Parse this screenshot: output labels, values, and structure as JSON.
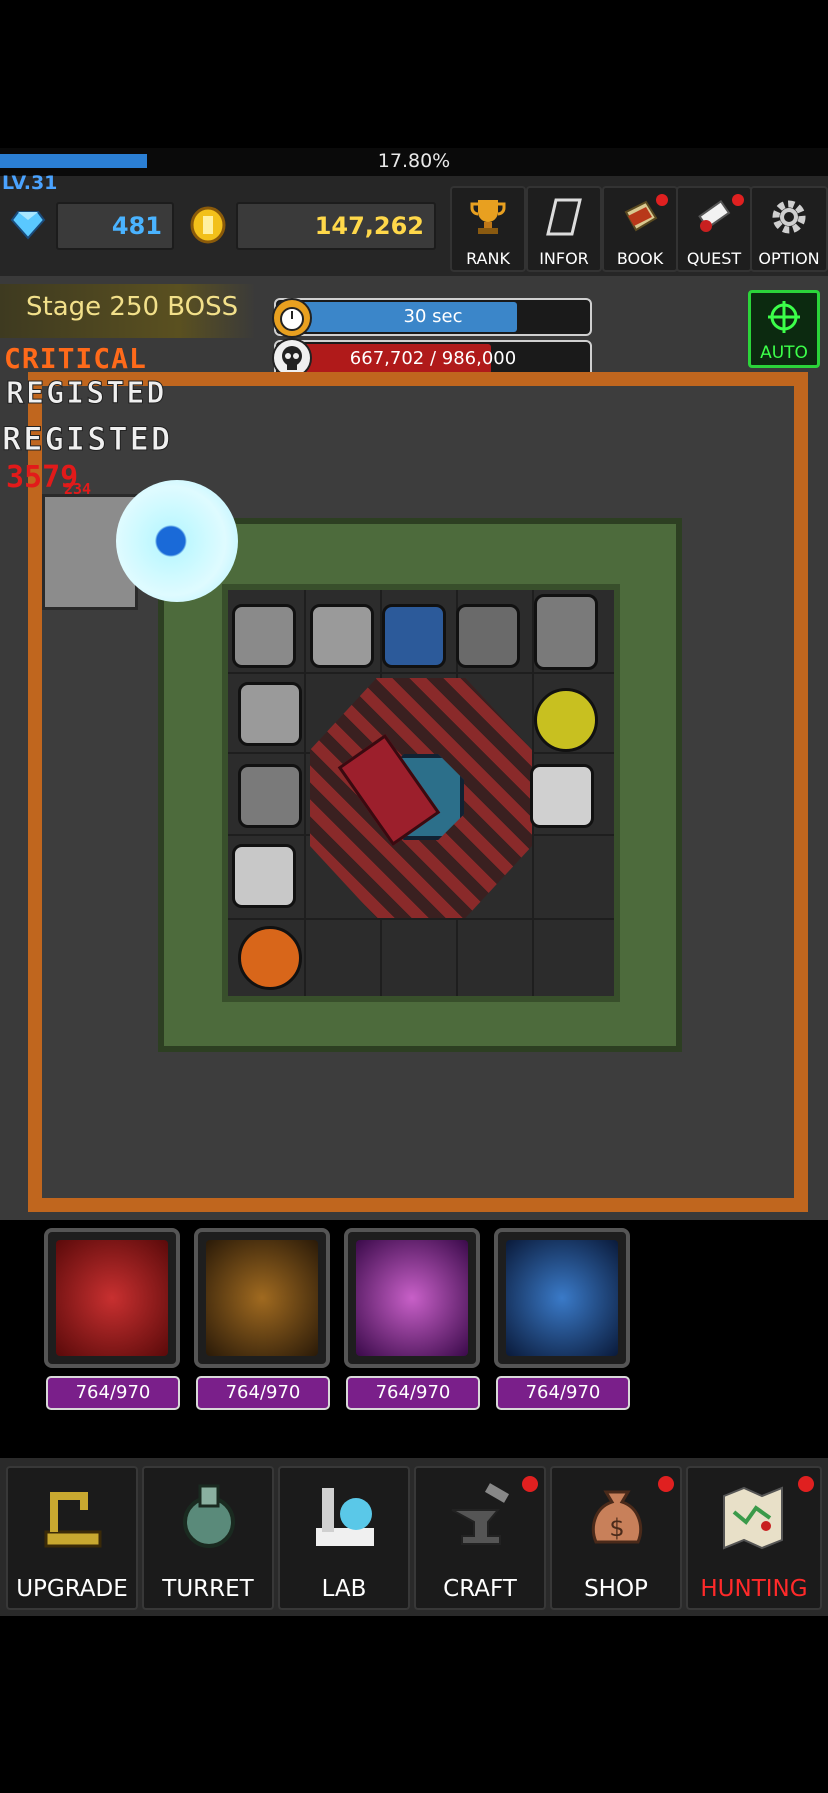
{
  "xp": {
    "percent_text": "17.80%",
    "progress": 0.178
  },
  "player": {
    "level": "LV.31"
  },
  "currency": {
    "gems": "481",
    "gold": "147,262"
  },
  "menu": [
    {
      "label": "RANK",
      "icon": "trophy-icon",
      "alert": false
    },
    {
      "label": "INFOR",
      "icon": "info-book-icon",
      "alert": false
    },
    {
      "label": "BOOK",
      "icon": "book-icon",
      "alert": true
    },
    {
      "label": "QUEST",
      "icon": "scroll-icon",
      "alert": true
    },
    {
      "label": "OPTION",
      "icon": "gear-icon",
      "alert": false
    }
  ],
  "stage": {
    "label": "Stage 250 BOSS"
  },
  "timer": {
    "text": "30 sec",
    "progress": 0.76
  },
  "boss_hp": {
    "text": "667,702 / 986,000",
    "progress": 0.677
  },
  "auto": {
    "label": "AUTO"
  },
  "combat_text": {
    "critical": "CRITICAL",
    "registed_1": "REGISTED",
    "registed_2": "REGISTED",
    "damage": "3579",
    "damage_small": "234"
  },
  "skills": [
    {
      "name": "bullet-skill",
      "charge": "764/970",
      "color": "#8a1a1a"
    },
    {
      "name": "target-skill",
      "charge": "764/970",
      "color": "#5a3a10"
    },
    {
      "name": "dash-skill",
      "charge": "764/970",
      "color": "#6a1a6a"
    },
    {
      "name": "tornado-skill",
      "charge": "764/970",
      "color": "#1a3a6a"
    }
  ],
  "nav": [
    {
      "label": "UPGRADE",
      "icon": "crane-icon",
      "alert": false,
      "active": false
    },
    {
      "label": "TURRET",
      "icon": "turret-icon",
      "alert": false,
      "active": false
    },
    {
      "label": "LAB",
      "icon": "lab-icon",
      "alert": false,
      "active": false
    },
    {
      "label": "CRAFT",
      "icon": "anvil-icon",
      "alert": true,
      "active": false
    },
    {
      "label": "SHOP",
      "icon": "money-bag-icon",
      "alert": true,
      "active": false
    },
    {
      "label": "HUNTING",
      "icon": "map-icon",
      "alert": true,
      "active": true
    }
  ],
  "colors": {
    "xp": "#2b7fd4",
    "timer": "#3b86c9",
    "hp": "#b01a1a",
    "accent_red": "#ff2a2a",
    "auto_green": "#2bd43a"
  }
}
